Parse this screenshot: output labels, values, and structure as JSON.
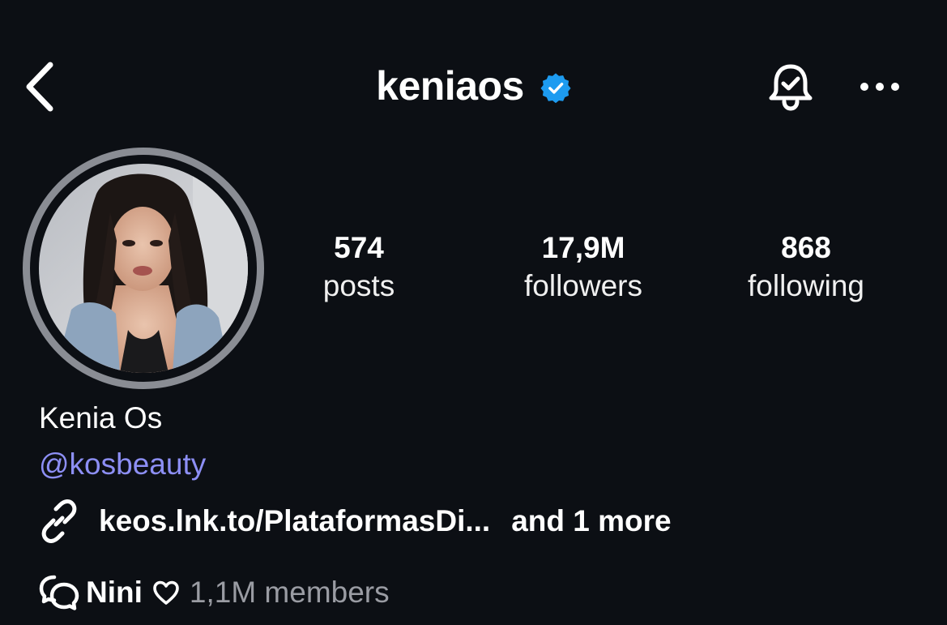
{
  "header": {
    "back_icon": "chevron-left-icon",
    "username": "keniaos",
    "verified_icon": "verified-badge-icon",
    "verified_color": "#1d9bf0",
    "bell_icon": "bell-check-icon",
    "more_icon": "more-horizontal-icon"
  },
  "profile": {
    "avatar": "profile-photo",
    "ring_color": "#8a8d94",
    "stats": [
      {
        "value": "574",
        "label": "posts"
      },
      {
        "value": "17,9M",
        "label": "followers"
      },
      {
        "value": "868",
        "label": "following"
      }
    ]
  },
  "bio": {
    "name": "Kenia Os",
    "handle": "@kosbeauty",
    "handle_color": "#8d8ff5",
    "link_icon": "link-icon",
    "link_text": "keos.lnk.to/PlataformasDi...",
    "link_more": "and 1 more",
    "channel_icon": "broadcast-channel-icon",
    "channel_name": "Nini",
    "channel_heart_icon": "heart-outline-icon",
    "channel_members": "1,1M members"
  }
}
